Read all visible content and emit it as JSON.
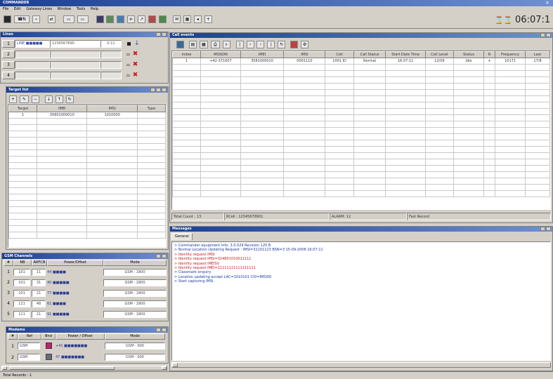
{
  "app": {
    "title": "COMMANDER",
    "menu": [
      "File",
      "Edit",
      "Gateway Lines",
      "Window",
      "Tools",
      "Help"
    ],
    "clock": "06:07:1"
  },
  "toolbar": {
    "icons": [
      "card-icon",
      "call-icon",
      "hold-icon",
      "transfer-icon",
      "new-icon",
      "end-icon",
      "group-icon",
      "map-icon",
      "settings-icon",
      "record-icon",
      "chart-icon",
      "phone-icon",
      "conf-icon",
      "mail-icon",
      "window-icon"
    ]
  },
  "lines_panel": {
    "title": "Lines",
    "rows": [
      {
        "num": "1",
        "name": "LINE ■■■■■",
        "number": "1234567890",
        "dur": "0:11",
        "state": "active"
      },
      {
        "num": "2",
        "name": "",
        "number": "",
        "dur": "",
        "state": "idle"
      },
      {
        "num": "3",
        "name": "",
        "number": "",
        "dur": "",
        "state": "idle"
      },
      {
        "num": "4",
        "name": "",
        "number": "",
        "dur": "",
        "state": "idle"
      }
    ]
  },
  "target_panel": {
    "title": "Target list",
    "headers": [
      "Target",
      "IMEI",
      "IMSI",
      "Type"
    ],
    "rows": [
      [
        "1",
        "35801000010",
        "1010000",
        " "
      ]
    ]
  },
  "calls_panel": {
    "title": "Call events",
    "headers": [
      "Index",
      "MSISDN",
      "IMEI",
      "IMSI",
      "Cell",
      "Call Status",
      "Start Date Time",
      "Call Level",
      "Status",
      "R",
      "Frequency",
      "Last"
    ],
    "rows": [
      [
        "1",
        "+42-371007",
        "3581000010",
        "0001110",
        "1001 ID",
        "Normal",
        "16:07:11",
        "12/09",
        "Idle",
        "+",
        "10171",
        "17/8"
      ]
    ],
    "status": {
      "total": "Total Count : 13",
      "rcell": "RCell : 12345678901",
      "alarm": "ALARM: 12",
      "fast": "Fast Record"
    }
  },
  "gsm_panel": {
    "title": "GSM Channels",
    "headers": [
      "#",
      "NB",
      "ARFCN",
      "Power/Offset",
      "Mode"
    ],
    "rows": [
      [
        "1",
        "101",
        "11",
        "44 ■■■■",
        "GSM - 1800"
      ],
      [
        "2",
        "101",
        "31",
        "40 ■■■■■",
        "GSM - 1800"
      ],
      [
        "3",
        "101",
        "21",
        "77 ■■■■■",
        "GSM - 1800"
      ],
      [
        "4",
        "111",
        "48",
        "61 ■■■■",
        "GSM - 1800"
      ],
      [
        "5",
        "111",
        "21",
        "91 ■■■■■",
        "GSM - 1800"
      ]
    ]
  },
  "modems_panel": {
    "title": "Modems",
    "headers": [
      "#",
      "Ref",
      "Bnd",
      "Power / Offset",
      "Mode"
    ],
    "rows": [
      [
        "1",
        "GSM",
        "",
        "+41 ■■■■■■■",
        "GSM - 900"
      ],
      [
        "2",
        "GSM",
        "",
        "47 ■■■■■■■",
        "GSM - 900"
      ]
    ]
  },
  "log_panel": {
    "title": "Messages",
    "tab": "General",
    "lines": [
      {
        "text": "> Commander equipment info: 3.0.029 Revision 120 B",
        "color": "#1a3a9c"
      },
      {
        "text": "> Normal Location Updating Request : IMSI=31101123 BSN=3 15-09-2008 16:07:11",
        "color": "#1a3a9c"
      },
      {
        "text": "> Identity request IMSI",
        "color": "#c02020"
      },
      {
        "text": "> Identity request IMSI=324801010011111",
        "color": "#c02020"
      },
      {
        "text": "> Identity request IMEISV",
        "color": "#c02020"
      },
      {
        "text": "> Identity request IMEI=11111111111111111",
        "color": "#c02020"
      },
      {
        "text": "> Classmark enquiry",
        "color": "#1a3a9c"
      },
      {
        "text": "> Location updating accept LAC=1010101 CID=IMSI00",
        "color": "#1a3a9c"
      },
      {
        "text": "> Start capturing IMSI",
        "color": "#1a3a9c"
      }
    ]
  },
  "statusbar": {
    "text": "Total Records : 1"
  }
}
